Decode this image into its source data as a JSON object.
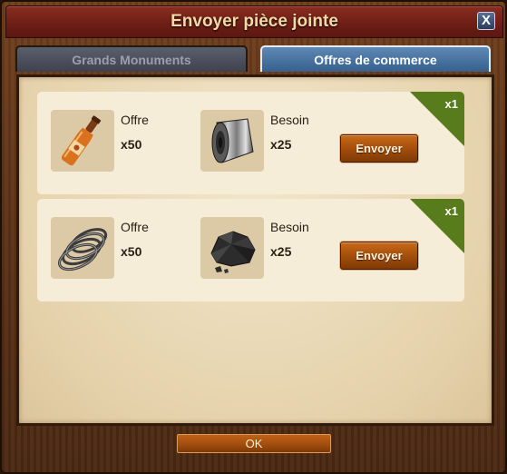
{
  "window": {
    "title": "Envoyer pièce jointe",
    "close_label": "X"
  },
  "tabs": [
    {
      "label": "Grands Monuments",
      "active": false
    },
    {
      "label": "Offres de commerce",
      "active": true
    }
  ],
  "offers": [
    {
      "offer_label": "Offre",
      "offer_qty": "x50",
      "offer_icon": "bottle-icon",
      "need_label": "Besoin",
      "need_qty": "x25",
      "need_icon": "metal-roll-icon",
      "button_label": "Envoyer",
      "badge": "x1"
    },
    {
      "offer_label": "Offre",
      "offer_qty": "x50",
      "offer_icon": "wire-coil-icon",
      "need_label": "Besoin",
      "need_qty": "x25",
      "need_icon": "coal-icon",
      "button_label": "Envoyer",
      "badge": "x1"
    }
  ],
  "footer": {
    "ok_label": "OK"
  },
  "colors": {
    "title_bar": "#6e1f16",
    "active_tab": "#35608f",
    "button": "#a44f0c",
    "badge": "#587c1c"
  }
}
